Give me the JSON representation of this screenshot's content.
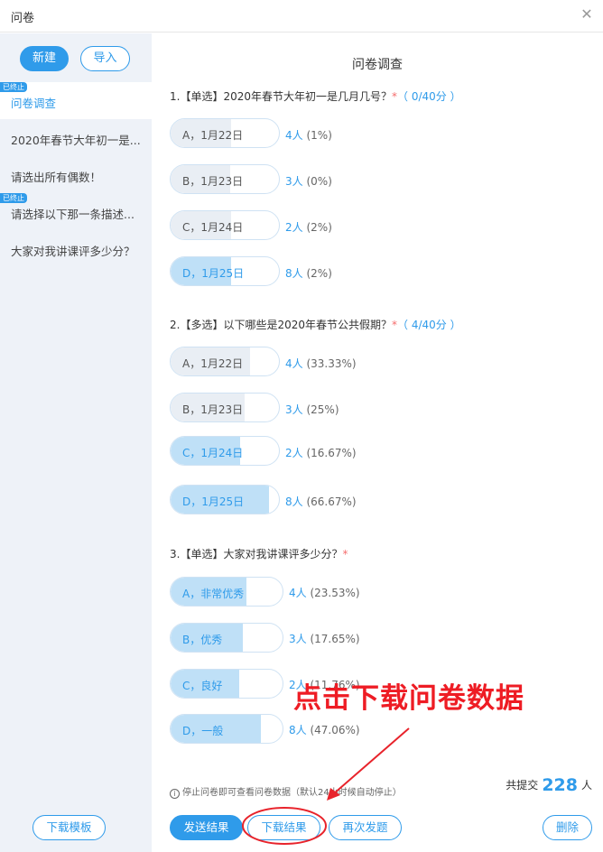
{
  "window": {
    "title": "问卷",
    "close_glyph": "✕"
  },
  "sidebar": {
    "new_label": "新建",
    "import_label": "导入",
    "items": [
      {
        "label": "问卷调查",
        "tag": "已终止",
        "active": true
      },
      {
        "label": "2020年春节大年初一是...",
        "tag": "",
        "active": false
      },
      {
        "label": "请选出所有偶数！",
        "tag": "",
        "active": false
      },
      {
        "label": "请选择以下那一条描述...",
        "tag": "已终止",
        "active": false
      },
      {
        "label": "大家对我讲课评多少分？",
        "tag": "",
        "active": false
      }
    ],
    "template_label": "下载模板"
  },
  "survey": {
    "title": "问卷调查",
    "questions": [
      {
        "text": "1.【单选】2020年春节大年初一是几月几号？",
        "required": "*",
        "score": "（ 0/40分 ）",
        "options": [
          {
            "label": "A，1月22日",
            "count": "4人",
            "pct": "(1%)",
            "fill": 0.01,
            "selected": false
          },
          {
            "label": "B，1月23日",
            "count": "3人",
            "pct": "(0%)",
            "fill": 0.0,
            "selected": false
          },
          {
            "label": "C，1月24日",
            "count": "2人",
            "pct": "(2%)",
            "fill": 0.02,
            "selected": false
          },
          {
            "label": "D，1月25日",
            "count": "8人",
            "pct": "(2%)",
            "fill": 0.02,
            "selected": true
          }
        ]
      },
      {
        "text": "2.【多选】以下哪些是2020年春节公共假期？",
        "required": "*",
        "score": "（ 4/40分 ）",
        "options": [
          {
            "label": "A，1月22日",
            "count": "4人",
            "pct": "(33.33%)",
            "fill": 0.3333,
            "selected": false
          },
          {
            "label": "B，1月23日",
            "count": "3人",
            "pct": "(25%)",
            "fill": 0.25,
            "selected": false
          },
          {
            "label": "C，1月24日",
            "count": "2人",
            "pct": "(16.67%)",
            "fill": 0.1667,
            "selected": true
          },
          {
            "label": "D，1月25日",
            "count": "8人",
            "pct": "(66.67%)",
            "fill": 0.6667,
            "selected": true
          }
        ]
      },
      {
        "text": "3.【单选】大家对我讲课评多少分？",
        "required": "*",
        "score": "",
        "options": [
          {
            "label": "A，非常优秀",
            "count": "4人",
            "pct": "(23.53%)",
            "fill": 0.2353,
            "selected": true
          },
          {
            "label": "B，优秀",
            "count": "3人",
            "pct": "(17.65%)",
            "fill": 0.1765,
            "selected": true
          },
          {
            "label": "C，良好",
            "count": "2人",
            "pct": "(11.76%)",
            "fill": 0.1176,
            "selected": true
          },
          {
            "label": "D，一般",
            "count": "8人",
            "pct": "(47.06%)",
            "fill": 0.4706,
            "selected": true
          }
        ]
      }
    ]
  },
  "footer": {
    "info_icon": "i",
    "note": "停止问卷即可查看问卷数据（默认24小时候自动停止）",
    "total_prefix": "共提交",
    "total_count": "228",
    "total_suffix": "人",
    "send_label": "发送结果",
    "download_label": "下载结果",
    "resend_label": "再次发题",
    "delete_label": "删除"
  },
  "annotation": {
    "text": "点击下载问卷数据",
    "color": "#ee1c24"
  },
  "colors": {
    "accent": "#2f9bea",
    "sidebar_bg": "#eef2f8",
    "required": "#f56c6c"
  }
}
